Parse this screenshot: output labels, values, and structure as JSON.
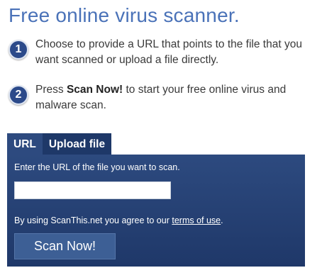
{
  "title": "Free online virus scanner.",
  "steps": [
    {
      "number": "1",
      "text": "Choose to provide a URL that points to the file that you want scanned or upload a file directly."
    },
    {
      "number": "2",
      "text_before": "Press ",
      "text_bold": "Scan Now!",
      "text_after": " to start your free online virus and malware scan."
    }
  ],
  "tabs": [
    {
      "label": "URL"
    },
    {
      "label": "Upload file"
    }
  ],
  "panel": {
    "instruction": "Enter the URL of the file you want to scan.",
    "url_input": {
      "value": "",
      "placeholder": ""
    },
    "agree_before": "By using ScanThis.net you agree to our ",
    "terms_link": "terms of use",
    "agree_after": ".",
    "scan_button": "Scan Now!"
  }
}
